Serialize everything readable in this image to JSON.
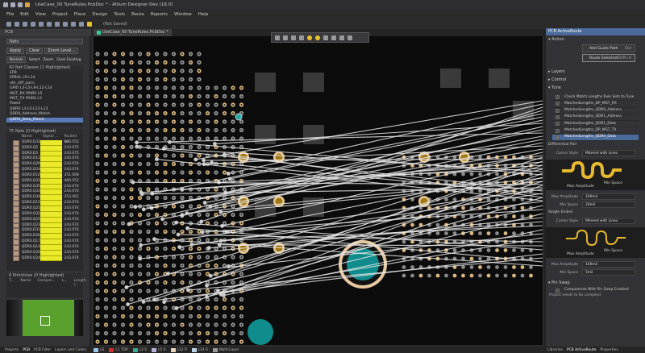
{
  "window": {
    "title": "UseCase_00 TuneRules.PcbDoc * - Altium Designer Dev (18.0)"
  },
  "menu": [
    "File",
    "Edit",
    "View",
    "Project",
    "Place",
    "Design",
    "Tools",
    "Route",
    "Reports",
    "Window",
    "Help"
  ],
  "toolbar": {
    "status": "(Not Saved)"
  },
  "doc_tab": "UseCase_00 TuneRules.PcbDoc *",
  "left_panel": {
    "title": "PCB",
    "mode": "Nets",
    "apply": "Apply",
    "clear": "Clear",
    "zoom_level": "Zoom Level...",
    "filter_mode": "Normal",
    "select": "Select",
    "zoom": "Zoom",
    "clear_existing": "Clear Existing",
    "classes_header": "42 Net Classes (1 Highlighted)",
    "classes": [
      "EPB",
      "EPBXL L9-L14",
      "eth_diff_pairs",
      "GPIO L3-L5-L9-L12-L14",
      "MGT_RX PAIRS L5",
      "MGT_TX PAIRS L3",
      "Power",
      "QDR0 L3-L5-L12-L13",
      "QDR0_Address_Match",
      "QDR0_Data_Match"
    ],
    "selected_class": 9,
    "nets_header": "75 Nets (0 Highlighted)",
    "net_cols": [
      "Name",
      "Signal ...",
      "Routed Le..."
    ],
    "nets": [
      [
        "QDR0.D33",
        "400.552"
      ],
      [
        "QDR0.Q5",
        "243.075"
      ],
      [
        "QDR0.D5",
        "243.075"
      ],
      [
        "QDR0.D12",
        "243.074"
      ],
      [
        "QDR0.Q26",
        "243.074"
      ],
      [
        "QDR0.D24",
        "243.074"
      ],
      [
        "QDR0.D10",
        "351.008"
      ],
      [
        "QDR0.Q31",
        "400.552"
      ],
      [
        "QDR0.Q35",
        "243.074"
      ],
      [
        "QDR0.Q33",
        "243.074"
      ],
      [
        "QDR0.Q34",
        "353.401"
      ],
      [
        "QDR0.D15",
        "243.074"
      ],
      [
        "QDR0.Q21",
        "243.074"
      ],
      [
        "QDR0.Q32",
        "243.074"
      ],
      [
        "QDR0.Q25",
        "243.074"
      ],
      [
        "QDR0.Q23",
        "243.074"
      ],
      [
        "QDR0.D31",
        "243.074"
      ],
      [
        "QDR0.D26",
        "243.074"
      ],
      [
        "QDR0.Q17",
        "243.074"
      ],
      [
        "QDR0.Q14",
        "243.074"
      ],
      [
        "QDR0.Q20",
        "243.074"
      ],
      [
        "QDR0.Q24",
        "243.074"
      ]
    ],
    "prims_header": "0 Primitives (0 Highlighted)",
    "prim_cols": [
      "T...",
      "Name",
      "Compon...",
      "L...",
      "Length (..."
    ],
    "tabs": [
      "Projects",
      "PCB",
      "PCB Filter",
      "Layers and Colors"
    ]
  },
  "right_panel": {
    "title": "PCB ActiveRoute",
    "action": "Action",
    "add_guide": "Add Guide Path",
    "add_guide_key": "Ctrl",
    "route_selected": "Route Selected",
    "route_key": "Shift+A",
    "layers": "Layers",
    "control": "Control",
    "tune": "Tune",
    "tune_items": [
      "Check Match Lengths Rule Sets to Tune",
      "MatchedLengths_DP_MGT_RX",
      "MatchedLengths_QDR0_Address",
      "MatchedLengths_QDR1_Address",
      "MatchedLengths_QDR1_Data",
      "MatchedLengths_DP_MGT_TX",
      "MatchedLengths_QDR0_Data"
    ],
    "diff_pair": "Differential Pair",
    "corner_label": "Corner Style",
    "corner_value": "Mitered with Lines",
    "max_amp_caption": "Max Amplitude",
    "min_space_caption": "Min Space",
    "max_amp_label": "Max Amplitude",
    "dp_max_amp": "100mil",
    "min_space_label": "Min Space",
    "dp_min_space": "20mil",
    "single_ended": "Single Ended",
    "se_max_amp": "100mil",
    "se_min_space": "5mil",
    "pin_swap": "Pin Swap",
    "pin_swap_components": "Components With Pin Swap Enabled",
    "project_note": "Project needs to be compiled",
    "tabs": [
      "Libraries",
      "PCB ActiveRoute",
      "Properties"
    ]
  },
  "layers": [
    {
      "name": "LS",
      "color": "#9fc5e8"
    },
    {
      "name": "L1 TOP",
      "color": "#d0312d"
    },
    {
      "name": "L2 S",
      "color": "#3aa88a"
    },
    {
      "name": "L5 S",
      "color": "#b9b0d8"
    },
    {
      "name": "L12 P",
      "color": "#e8d4b8"
    },
    {
      "name": "L14 S",
      "color": "#bcd0e0"
    },
    {
      "name": "Multi-Layer",
      "color": "#9a9a9a"
    }
  ],
  "colors": {
    "accent": "#4a6b9a",
    "highlight": "#eaea2a",
    "pad_gold": "#e0c080",
    "teal": "#108c8c"
  }
}
